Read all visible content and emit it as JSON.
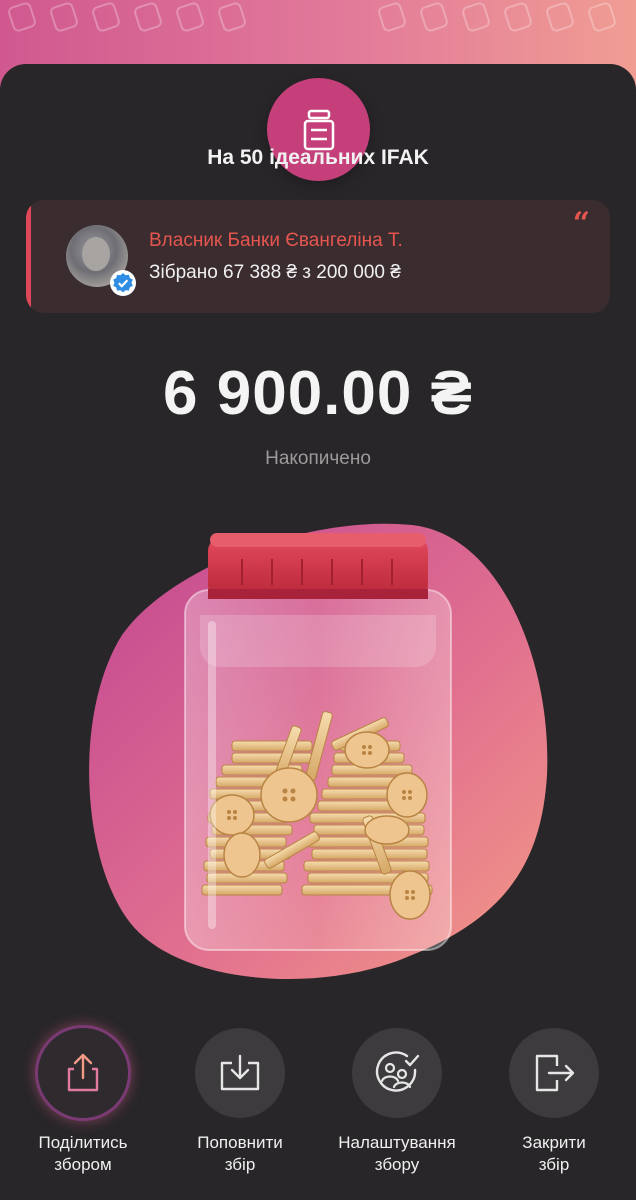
{
  "jar": {
    "title": "На 50 ідеальних IFAK",
    "badge_icon": "jar-icon",
    "accent_color": "#c5407a"
  },
  "owner": {
    "name": "Власник Банки Євангеліна Т.",
    "collected": "Зібрано 67 388 ₴ з 200 000 ₴",
    "avatar_icon": "avatar",
    "verified_icon": "verified-check-icon",
    "quote_icon": "quote-icon",
    "name_color": "#e6564f"
  },
  "balance": {
    "amount": "6 900.00 ₴",
    "label": "Накопичено"
  },
  "actions": [
    {
      "label": "Поділитись\nзбором",
      "icon": "share-icon",
      "active": true
    },
    {
      "label": "Поповнити\nзбір",
      "icon": "top-up-icon",
      "active": false
    },
    {
      "label": "Налаштування\nзбору",
      "icon": "settings-icon",
      "active": false
    },
    {
      "label": "Закрити\nзбір",
      "icon": "exit-icon",
      "active": false
    }
  ]
}
